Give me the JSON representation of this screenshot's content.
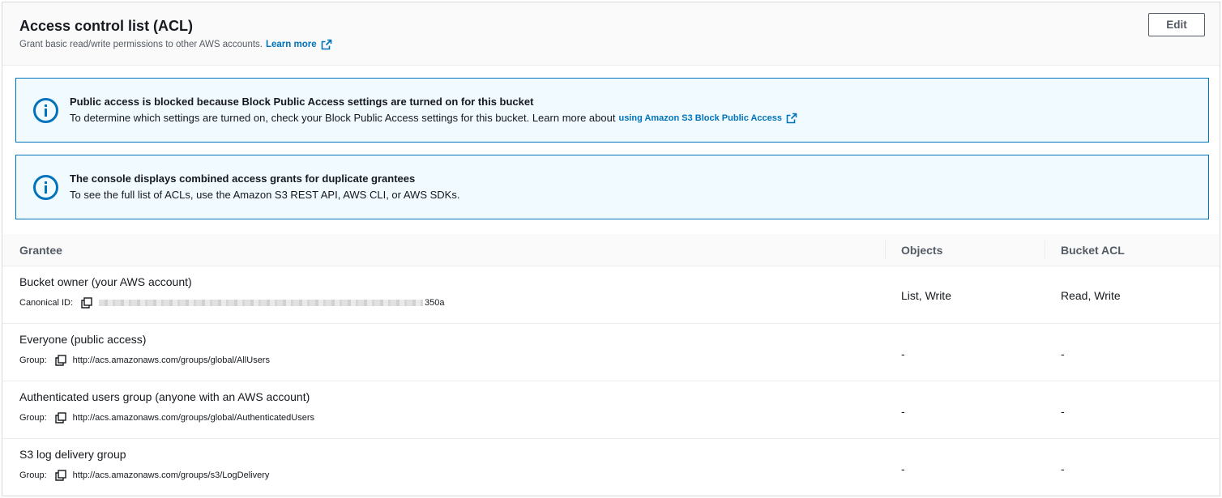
{
  "header": {
    "title": "Access control list (ACL)",
    "description": "Grant basic read/write permissions to other AWS accounts.",
    "learn_more": "Learn more",
    "edit_label": "Edit"
  },
  "alerts": [
    {
      "title": "Public access is blocked because Block Public Access settings are turned on for this bucket",
      "text": "To determine which settings are turned on, check your Block Public Access settings for this bucket. Learn more about",
      "link": "using Amazon S3 Block Public Access"
    },
    {
      "title": "The console displays combined access grants for duplicate grantees",
      "text": "To see the full list of ACLs, use the Amazon S3 REST API, AWS CLI, or AWS SDKs."
    }
  ],
  "table": {
    "columns": [
      "Grantee",
      "Objects",
      "Bucket ACL"
    ],
    "rows": [
      {
        "name": "Bucket owner (your AWS account)",
        "sub_label": "Canonical ID:",
        "sub_value": "350a",
        "objects": "List, Write",
        "bucket_acl": "Read, Write"
      },
      {
        "name": "Everyone (public access)",
        "sub_label": "Group:",
        "sub_value": "http://acs.amazonaws.com/groups/global/AllUsers",
        "objects": "-",
        "bucket_acl": "-"
      },
      {
        "name": "Authenticated users group (anyone with an AWS account)",
        "sub_label": "Group:",
        "sub_value": "http://acs.amazonaws.com/groups/global/AuthenticatedUsers",
        "objects": "-",
        "bucket_acl": "-"
      },
      {
        "name": "S3 log delivery group",
        "sub_label": "Group:",
        "sub_value": "http://acs.amazonaws.com/groups/s3/LogDelivery",
        "objects": "-",
        "bucket_acl": "-"
      }
    ]
  },
  "icons": {
    "info": "info-circle-icon",
    "external_link": "external-link-icon",
    "copy": "copy-icon"
  },
  "colors": {
    "link": "#0073bb",
    "alert_border": "#0073bb",
    "alert_bg": "#f1faff",
    "text": "#16191f"
  }
}
